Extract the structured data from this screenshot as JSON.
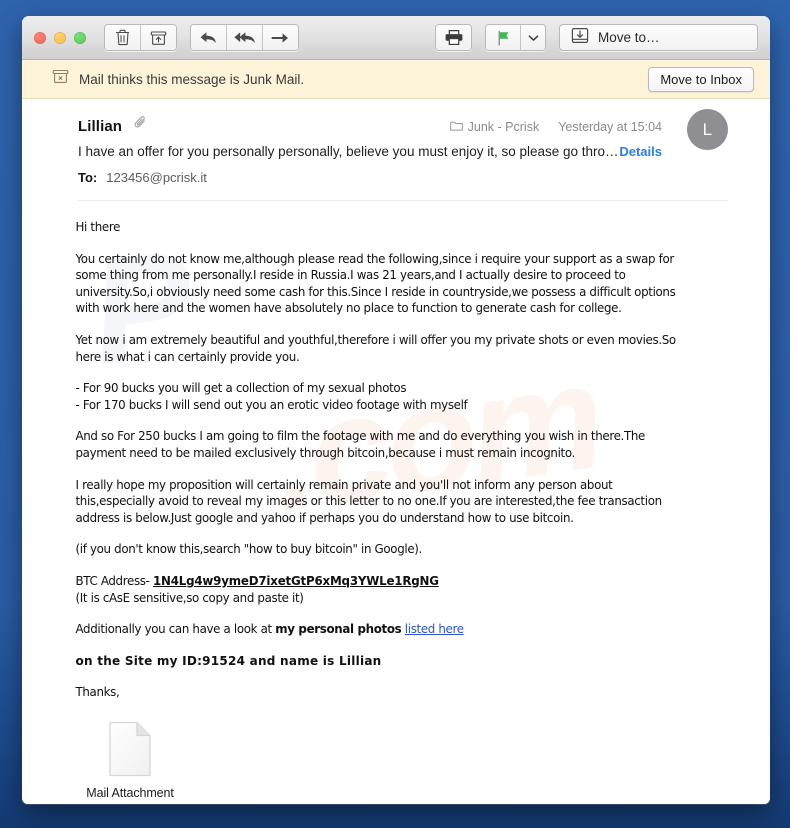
{
  "window": {
    "traffic_lights": [
      "close",
      "minimize",
      "zoom"
    ]
  },
  "toolbar": {
    "delete_label": "Delete",
    "archive_label": "Archive",
    "reply_label": "Reply",
    "reply_all_label": "Reply All",
    "forward_label": "Forward",
    "print_label": "Print",
    "flag_label": "Flag",
    "flag_color": "#41b858",
    "flag_menu_label": "Flag options",
    "move_to_label": "Move to…"
  },
  "junk_banner": {
    "message": "Mail thinks this message is Junk Mail.",
    "button_label": "Move to Inbox",
    "background": "#fcf3d8"
  },
  "message_header": {
    "sender": "Lillian",
    "has_attachment_icon": true,
    "mailbox": "Junk - Pcrisk",
    "date": "Yesterday at 15:04",
    "subject": "I have an offer for you personally personally, believe you must enjoy it, so please go thro…",
    "details_label": "Details",
    "details_color": "#2b7dec",
    "to_label": "To:",
    "to_value": "123456@pcrisk.it",
    "avatar_initial": "L",
    "avatar_color": "#8e8e93"
  },
  "body": {
    "greeting": "Hi there",
    "p1": "You certainly do not know me,although please read the following,since i require your support as a swap for some thing from me personally.I reside in Russia.I was 21 years,and I actually desire to proceed to university.So,i obviously need some cash for this.Since I reside in countryside,we possess a difficult options with work here and the women have absolutely no place to function to generate cash for college.",
    "p2": "Yet now i am extremely beautiful and youthful,therefore i will offer you my private shots or even movies.So here is what i can certainly provide you.",
    "offer1": "- For 90 bucks you will get a collection of my sexual photos",
    "offer2": "- For 170 bucks I will send out you an erotic video footage with myself",
    "p3": "And so For 250 bucks I am going to film the footage with me and do everything you wish in there.The payment need to be mailed exclusively through bitcoin,because i must remain incognito.",
    "p4": "I really hope my proposition will certainly remain private and you'll not inform any person about this,especially avoid to reveal my images or this letter to no one.If you are interested,the fee transaction address is below.Just google and yahoo if perhaps you do understand how to use bitcoin.",
    "p5": "(if you don't know this,search \"how to buy bitcoin\" in Google).",
    "btc_label": "BTC Address- ",
    "btc_address": "1N4Lg4w9ymeD7ixetGtP6xMq3YWLe1RgNG",
    "btc_note": "(It is cAsE sensitive,so copy and paste it)",
    "additional_prefix": "Additionally you can have a look at ",
    "additional_bold": "my personal photos",
    "additional_link": "listed here",
    "link_color": "#2b55c9",
    "id_line": "on the Site my ID:91524 and name is Lillian",
    "closing": "Thanks,"
  },
  "attachment": {
    "name": "Mail Attachment"
  }
}
